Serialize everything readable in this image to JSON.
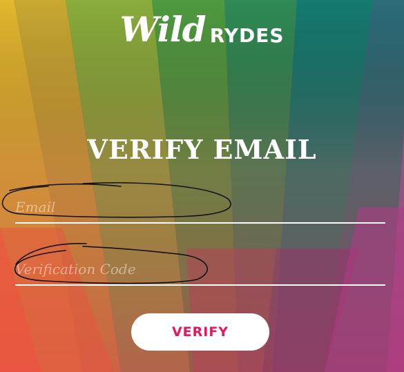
{
  "brand": {
    "script": "Wild",
    "caps": "RYDES"
  },
  "title": "VERIFY EMAIL",
  "form": {
    "email_placeholder": "Email",
    "email_value": "",
    "code_placeholder": "Verification Code",
    "code_value": "",
    "submit_label": "VERIFY"
  },
  "colors": {
    "accent": "#e8175d",
    "text": "#ffffff"
  }
}
